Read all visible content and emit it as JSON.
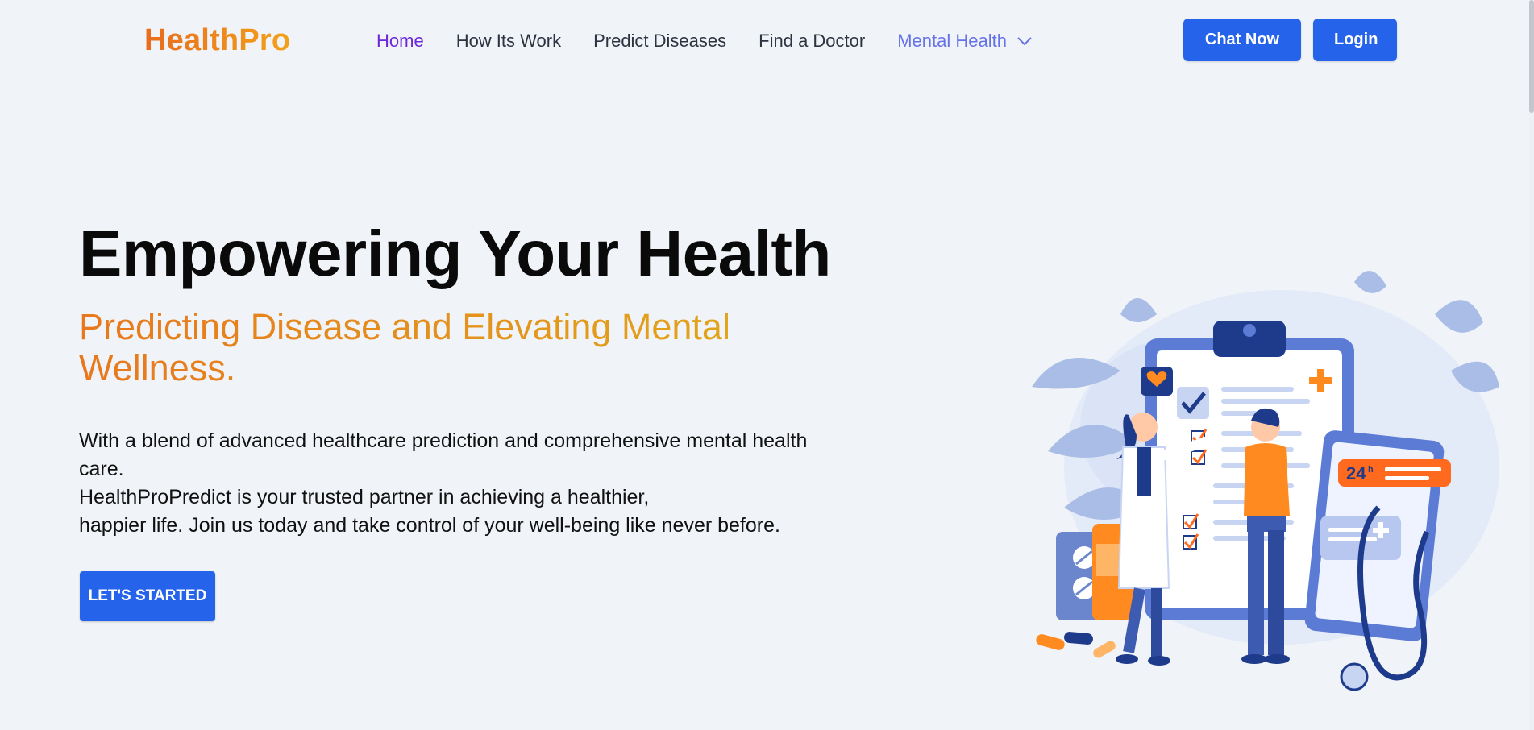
{
  "nav": {
    "logo": "HealthPro",
    "links": [
      {
        "label": "Home",
        "active": true
      },
      {
        "label": "How Its Work"
      },
      {
        "label": "Predict Diseases"
      },
      {
        "label": "Find a Doctor"
      },
      {
        "label": "Mental Health",
        "has_dropdown": true
      }
    ],
    "chat_button": "Chat Now",
    "login_button": "Login"
  },
  "hero": {
    "title": "Empowering Your Health",
    "subtitle": "Predicting Disease and Elevating Mental Wellness.",
    "description_lines": [
      "With a blend of advanced healthcare prediction and comprehensive mental health care.",
      "HealthProPredict is your trusted partner in achieving a healthier,",
      "happier life. Join us today and take control of your well-being like never before."
    ],
    "cta_button": "LET'S STARTED",
    "illustration": {
      "badge_text": "24",
      "badge_suffix": "h"
    }
  },
  "colors": {
    "primary": "#2563eb",
    "logo_gradient_start": "#e96b1c",
    "logo_gradient_end": "#f2a21b",
    "active_link": "#6d28d9",
    "mental_health_link": "#6672e8",
    "background": "#f0f3f8"
  },
  "icons": {
    "dropdown": "chevron-down-icon"
  }
}
